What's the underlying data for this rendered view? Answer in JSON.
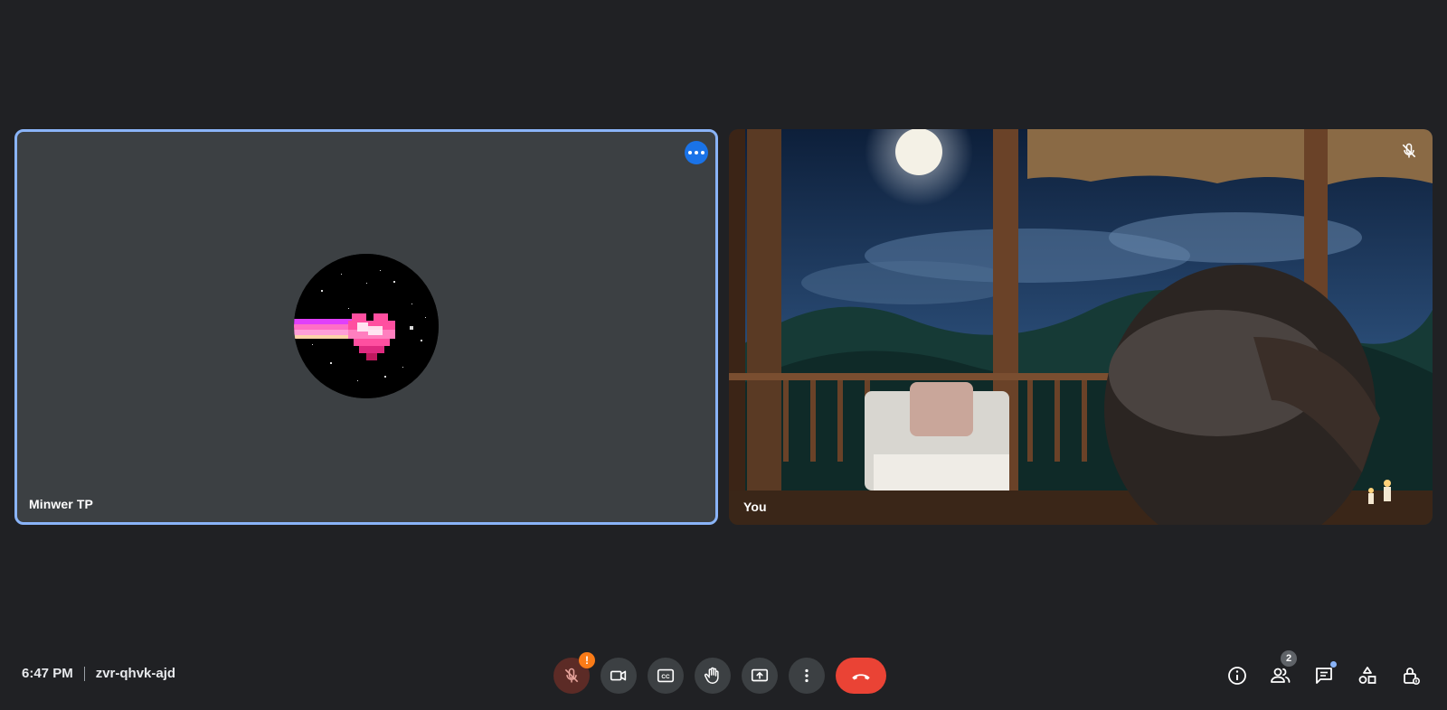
{
  "participants": [
    {
      "name": "Minwer TP",
      "muted": false,
      "video": false,
      "active_speaker": true
    },
    {
      "name": "You",
      "muted": true,
      "video": true
    }
  ],
  "meeting": {
    "time": "6:47 PM",
    "code": "zvr-qhvk-ajd"
  },
  "controls": {
    "mic_warning": "!",
    "items": [
      "mic-off-icon",
      "camera-icon",
      "captions-icon",
      "raise-hand-icon",
      "present-icon",
      "more-options-icon",
      "end-call-icon"
    ]
  },
  "side_panel": {
    "people_count": "2",
    "items": [
      "info-icon",
      "people-icon",
      "chat-icon",
      "activities-icon",
      "host-controls-icon"
    ]
  },
  "colors": {
    "background": "#202124",
    "tile": "#3c4043",
    "active_border": "#8ab4f8",
    "end_call": "#ea4335",
    "warning": "#fa7b17",
    "accent": "#1a73e8"
  }
}
